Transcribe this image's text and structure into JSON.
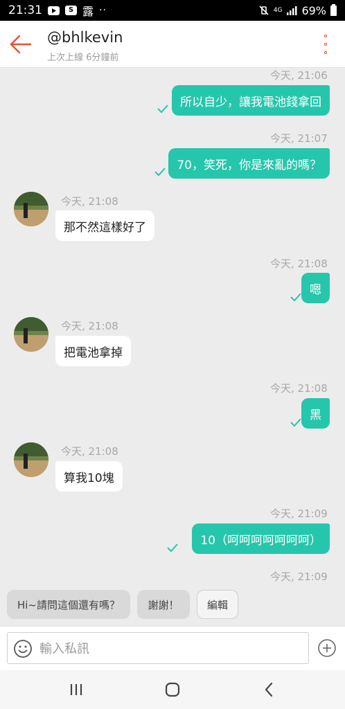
{
  "status_bar": {
    "time": "21:31",
    "app_icon_label": "露",
    "network": "4G",
    "battery": "69%",
    "icons": [
      "youtube-icon",
      "shopee-icon",
      "app-icon",
      "more-dots-icon",
      "mute-vibrate-icon",
      "network-icon",
      "signal-icon",
      "battery-icon"
    ]
  },
  "header": {
    "title": "@bhlkevin",
    "subtitle": "上次上線 6分鐘前",
    "back_icon": "back-arrow-icon",
    "more_icon": "more-vertical-icon",
    "accent_color": "#ee4d2d"
  },
  "messages": [
    {
      "direction": "out",
      "time": "今天, 21:06",
      "text": "所以自少，讓我電池錢拿回",
      "status": "sent"
    },
    {
      "direction": "out",
      "time": "今天, 21:07",
      "text": "70，笑死，你是來亂的嗎？",
      "status": "sent"
    },
    {
      "direction": "in",
      "time": "今天, 21:08",
      "text": "那不然這樣好了"
    },
    {
      "direction": "out",
      "time": "今天, 21:08",
      "text": "嗯",
      "status": "sent"
    },
    {
      "direction": "in",
      "time": "今天, 21:08",
      "text": "把電池拿掉"
    },
    {
      "direction": "out",
      "time": "今天, 21:08",
      "text": "黑",
      "status": "sent"
    },
    {
      "direction": "in",
      "time": "今天, 21:08",
      "text": "算我10塊"
    },
    {
      "direction": "out",
      "time": "今天, 21:09",
      "text": "10（呵呵呵呵呵呵呵）",
      "status": "sent"
    }
  ],
  "trailing_time": "今天, 21:09",
  "quick_replies": [
    "Hi~請問這個還有嗎？",
    "謝謝！",
    "編輯"
  ],
  "input": {
    "placeholder": "輸入私訊",
    "value": ""
  },
  "colors": {
    "outgoing_bubble": "#26c6ac",
    "incoming_bubble": "#ffffff",
    "chat_background": "#ececec"
  }
}
